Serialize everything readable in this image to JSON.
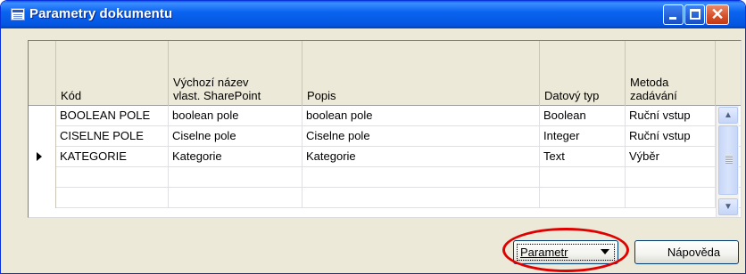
{
  "window": {
    "title": "Parametry dokumentu"
  },
  "grid": {
    "columns": [
      {
        "line1": "",
        "line2": "Kód"
      },
      {
        "line1": "Výchozí název",
        "line2": "vlast. SharePoint"
      },
      {
        "line1": "",
        "line2": "Popis"
      },
      {
        "line1": "",
        "line2": "Datový typ"
      },
      {
        "line1": "Metoda",
        "line2": "zadávání"
      }
    ],
    "rows": [
      {
        "code": "BOOLEAN POLE",
        "sp_name": "boolean pole",
        "desc": "boolean pole",
        "type": "Boolean",
        "method": "Ruční vstup"
      },
      {
        "code": "CISELNE POLE",
        "sp_name": "Ciselne pole",
        "desc": "Ciselne pole",
        "type": "Integer",
        "method": "Ruční vstup"
      },
      {
        "code": "KATEGORIE",
        "sp_name": "Kategorie",
        "desc": "Kategorie",
        "type": "Text",
        "method": "Výběr"
      },
      {
        "code": "",
        "sp_name": "",
        "desc": "",
        "type": "",
        "method": ""
      },
      {
        "code": "",
        "sp_name": "",
        "desc": "",
        "type": "",
        "method": ""
      }
    ],
    "selected_row_index": 2
  },
  "buttons": {
    "parametr": "Parametr",
    "napoveda": "Nápověda"
  },
  "scrollbar": {
    "up": "▲",
    "down": "▼"
  },
  "annotation": {
    "color": "#E00000"
  }
}
